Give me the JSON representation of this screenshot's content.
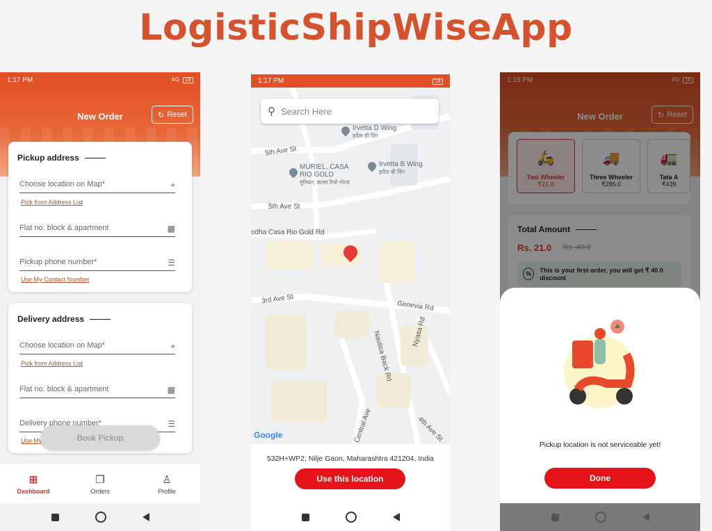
{
  "headline": "LogisticShipWiseApp",
  "phone1": {
    "status_time": "1:17 PM",
    "status_right": "4G",
    "battery": "18",
    "title": "New Order",
    "reset_label": "Reset",
    "pickup": {
      "heading": "Pickup address",
      "location_placeholder": "Choose location on Map",
      "address_list_link": "Pick from Address List",
      "flat_placeholder": "Flat no. block & apartment",
      "phone_placeholder": "Pickup phone number",
      "contact_link": "Use My Contact Number"
    },
    "delivery": {
      "heading": "Delivery address",
      "location_placeholder": "Choose location on Map",
      "address_list_link": "Pick from Address List",
      "flat_placeholder": "Flat no. block & apartment",
      "phone_placeholder": "Delivery phone number",
      "contact_link": "Use My"
    },
    "required_mark": "*",
    "book_button": "Book Pickup",
    "tabs": [
      {
        "label": "Dashboard",
        "icon": "grid-icon",
        "active": true
      },
      {
        "label": "Orders",
        "icon": "box-icon",
        "active": false
      },
      {
        "label": "Profile",
        "icon": "person-icon",
        "active": false
      }
    ]
  },
  "phone2": {
    "status_time": "1:17 PM",
    "search_placeholder": "Search Here",
    "map_labels": {
      "street1": "5th Ave St",
      "street2": "5th Ave St",
      "street3": "3rd Ave St",
      "street4": "Genevia Rd",
      "street5": "Nyasa Rd",
      "street6": "Nautica Back Rd",
      "street7": "Central Ave",
      "street8": "4th Ave St",
      "street9": "odha Casa Rio Gold Rd"
    },
    "pois": [
      {
        "name": "Irvetta D Wing",
        "sub": "इर्वेता डी विंग"
      },
      {
        "name": "MURIEL, CASA RIO GOLD",
        "sub": "मुरियल, कासा रियो गोल्ड"
      },
      {
        "name": "Irvetta B Wing",
        "sub": "इर्वेता बी विंग"
      }
    ],
    "google": "Google",
    "address": "532H+WP2, Nilje Gaon, Maharashtra 421204, India",
    "use_button": "Use this location"
  },
  "phone3": {
    "status_time": "1:19 PM",
    "title": "New Order",
    "reset_label": "Reset",
    "vehicles": [
      {
        "name": "Two Wheeler",
        "price": "₹21.0",
        "selected": true
      },
      {
        "name": "Three Wheeler",
        "price": "₹285.0",
        "selected": false
      },
      {
        "name": "Tata A",
        "price": "₹439",
        "selected": false
      }
    ],
    "total_label": "Total Amount",
    "total_value": "Rs. 21.0",
    "total_old": "Rs. 40.0",
    "first_order_msg": "This is your first order, you will get ₹ 40.0 discount",
    "sheet_message": "Pickup location is not serviceable yet!",
    "done_button": "Done"
  },
  "colors": {
    "brand": "#e14f24",
    "accent_red": "#e5141b",
    "headline": "#d4532e"
  }
}
